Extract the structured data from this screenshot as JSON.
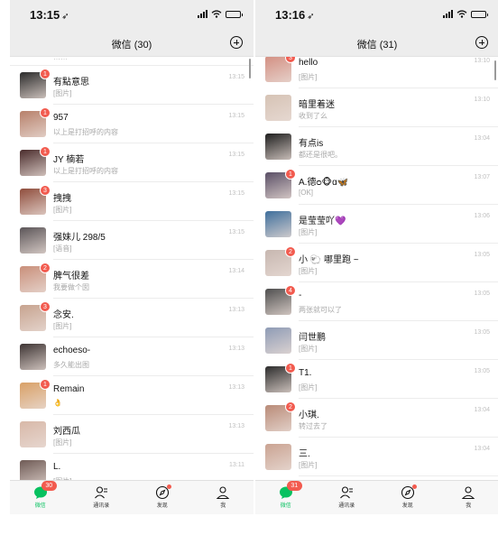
{
  "left": {
    "status": {
      "time": "13:15"
    },
    "title": "微信 (30)",
    "cutoff_text": "……",
    "rows": [
      {
        "name": "有點意思",
        "preview": "[图片]",
        "time": "13:15",
        "badge": "1",
        "avatar": "#2a2a2a"
      },
      {
        "name": "957",
        "preview": "以上是打招呼的内容",
        "time": "13:15",
        "badge": "1",
        "avatar": "#b7806a"
      },
      {
        "name": "JY 楠若",
        "preview": "以上是打招呼的内容",
        "time": "13:15",
        "badge": "1",
        "avatar": "#4a2c2c"
      },
      {
        "name": "拽拽",
        "preview": "[图片]",
        "time": "13:15",
        "badge": "3",
        "avatar": "#8f4d3c"
      },
      {
        "name": "强妹儿 298/5",
        "preview": "[语音]",
        "time": "13:15",
        "badge": "",
        "avatar": "#5b5558"
      },
      {
        "name": "脾气很差",
        "preview": "我要做个囡",
        "time": "13:14",
        "badge": "2",
        "avatar": "#c98f7a"
      },
      {
        "name": "念安.",
        "preview": "[图片]",
        "time": "13:13",
        "badge": "3",
        "avatar": "#c7a38f"
      },
      {
        "name": "echoeso-",
        "preview": "多久能出图",
        "time": "13:13",
        "badge": "",
        "avatar": "#3d3433"
      },
      {
        "name": "Remain",
        "preview": "👌",
        "time": "13:13",
        "badge": "1",
        "avatar": "#d9a066"
      },
      {
        "name": "刘西瓜",
        "preview": "[图片]",
        "time": "13:13",
        "badge": "",
        "avatar": "#d8b8a8"
      },
      {
        "name": "L.",
        "preview": "[图片]",
        "time": "13:11",
        "badge": "",
        "avatar": "#6e5a55"
      }
    ],
    "tabbar": {
      "chats": "微信",
      "contacts": "通讯录",
      "discover": "发现",
      "me": "我",
      "chats_badge": "30"
    }
  },
  "right": {
    "status": {
      "time": "13:16"
    },
    "title": "微信 (31)",
    "rows": [
      {
        "name": "hello",
        "preview": "[图片]",
        "time": "13:10",
        "badge": "3",
        "avatar": "#d38f82"
      },
      {
        "name": "暗里着迷",
        "preview": "收到了么",
        "time": "13:10",
        "badge": "",
        "avatar": "#d6c3b5"
      },
      {
        "name": "有点is",
        "preview": "都还是很吧。",
        "time": "13:04",
        "badge": "",
        "avatar": "#1e1e1e"
      },
      {
        "name": "A.德",
        "name_emoji": "ᴑ🐵ɑ",
        "name_emoji2": "🦋",
        "preview": "[OK]",
        "time": "13:07",
        "badge": "1",
        "avatar": "#5a4f66"
      },
      {
        "name": "是莹莹吖",
        "name_emoji": "💜",
        "preview": "[图片]",
        "time": "13:06",
        "badge": "",
        "avatar": "#3f6f9c"
      },
      {
        "name": "小 🐑  哪里跑 ~",
        "preview": "[图片]",
        "time": "13:05",
        "badge": "2",
        "avatar": "#c7b7b0"
      },
      {
        "name": "-",
        "preview": "两张就可以了",
        "time": "13:05",
        "badge": "4",
        "avatar": "#4f4f4f"
      },
      {
        "name": "闫世鹏",
        "preview": "[图片]",
        "time": "13:05",
        "badge": "",
        "avatar": "#8e9bb5"
      },
      {
        "name": "T1.",
        "preview": "[图片]",
        "time": "13:05",
        "badge": "1",
        "avatar": "#2c2c2c"
      },
      {
        "name": "小琪.",
        "preview": "转过去了",
        "time": "13:04",
        "badge": "2",
        "avatar": "#b98b78"
      },
      {
        "name": "三.",
        "preview": "[图片]",
        "time": "13:04",
        "badge": "",
        "avatar": "#caa392"
      }
    ],
    "tabbar": {
      "chats": "微信",
      "contacts": "通讯录",
      "discover": "发现",
      "me": "我",
      "chats_badge": "31"
    }
  },
  "colors": {
    "wechat_green": "#07c160",
    "badge_red": "#f25b4f",
    "header_bg": "#ededed"
  }
}
